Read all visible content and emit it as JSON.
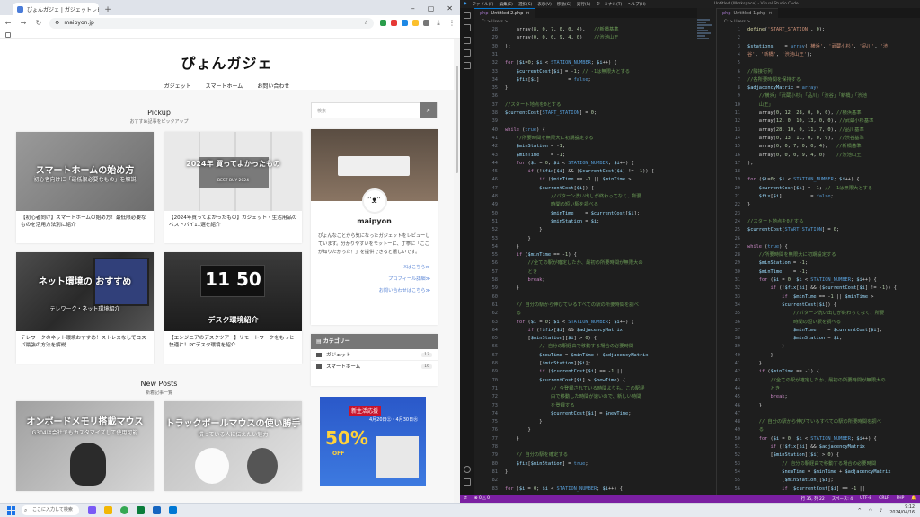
{
  "browser": {
    "tab_title": "ぴょんガジェ | ガジェットレビューブログ",
    "url": "maipyon.jp"
  },
  "site": {
    "logo": "ぴょんガジェ",
    "nav": [
      "ガジェット",
      "スマートホーム",
      "お問い合わせ"
    ],
    "pickup": {
      "title": "Pickup",
      "subtitle": "おすすめ記事をピックアップ"
    },
    "pickup_cards": [
      {
        "thumb_title": "スマートホームの始め方",
        "thumb_sub": "初心者向けに「最低限必要なもの」を解説",
        "title": "【初心者向け】スマートホームの始め方！最低限必要なものを活用方法別に紹介"
      },
      {
        "thumb_title": "2024年 買ってよかったもの",
        "thumb_sub": "BEST BUY 2024",
        "title": "【2024年買ってよかったもの】ガジェット・生活用品のベストバイ11選を紹介"
      },
      {
        "thumb_title": "ネット環境の おすすめ",
        "thumb_sub": "テレワーク・ネット環境紹介",
        "title": "テレワークのネット環境おすすめ！ストレスなしでコスパ最強の方法を解説"
      },
      {
        "thumb_title": "11 50",
        "thumb_sub": "デスク環境紹介",
        "title": "【エンジニアのデスクツアー】リモートワークをもっと快適に！PCデスク環境を紹介"
      }
    ],
    "newposts": {
      "title": "New Posts",
      "subtitle": "新着記事一覧"
    },
    "new_cards": [
      {
        "thumb_title": "オンボードメモリ搭載マウス",
        "thumb_sub": "G304は会社でもカスタマイズして使用可能"
      },
      {
        "thumb_title": "トラックボールマウスの使い勝手",
        "thumb_sub": "慣っている人に伝えたい魅力"
      }
    ]
  },
  "sidebar": {
    "search_placeholder": "検索",
    "profile_name": "maipyon",
    "profile_desc": "ぴょんなことから気になったガジェットをレビューしています。分かりやすいをモットーに、丁寧に「ここが知りたかった！」を提供できると嬉しいです。",
    "links": [
      "Xはこちら≫",
      "プロフィール詳細≫",
      "お問い合わせはこちら≫"
    ],
    "category_title": "カテゴリー",
    "categories": [
      {
        "name": "ガジェット",
        "count": "17"
      },
      {
        "name": "スマートホーム",
        "count": "16"
      }
    ],
    "ad": {
      "tag": "新生活応援",
      "big": "50%",
      "date": "4月20日㊏・4月30日㊋",
      "badge": "OFF"
    }
  },
  "vscode": {
    "title": "Untitled (Workspace) - Visual Studio Code",
    "menu": [
      "ファイル(F)",
      "編集(E)",
      "選択(S)",
      "表示(V)",
      "移動(G)",
      "実行(R)",
      "ターミナル(T)",
      "ヘルプ(H)"
    ],
    "left_tab": "Untitled-2.php",
    "right_tab": "Untitled-1.php",
    "breadcrumb": "C: > Users > ",
    "status_left": "⊗ 0 △ 0",
    "status_right": [
      "行 35, 列 22",
      "スペース: 4",
      "UTF-8",
      "CRLF",
      "PHP"
    ]
  },
  "taskbar": {
    "search": "ここに入力して検索",
    "time": "9:12",
    "date": "2024/04/16"
  }
}
